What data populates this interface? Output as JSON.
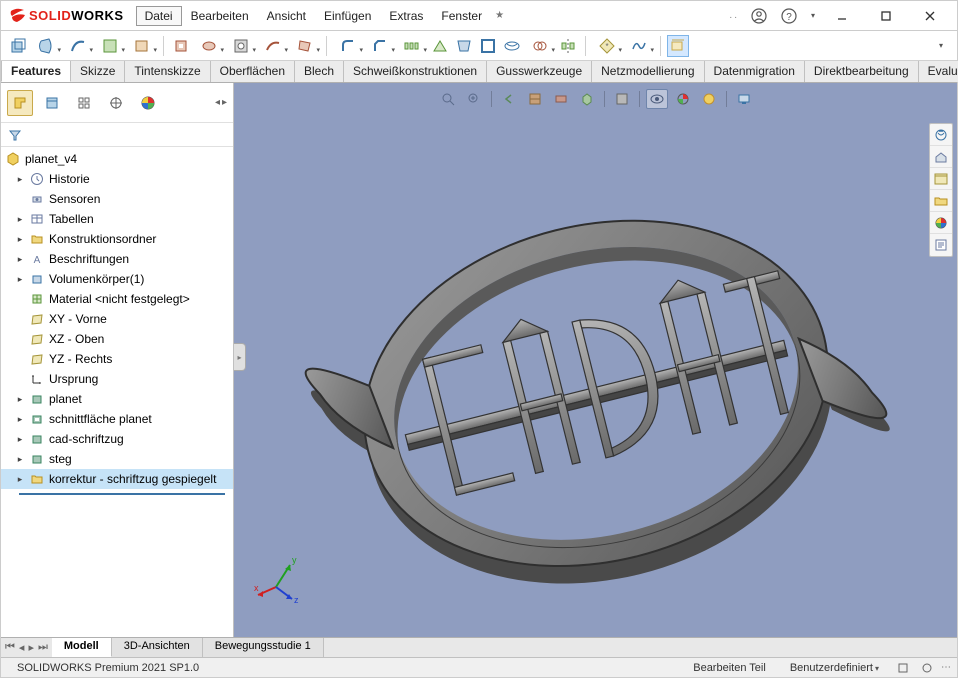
{
  "app": {
    "brand_solid": "SOLID",
    "brand_works": "WORKS"
  },
  "menu": {
    "file": "Datei",
    "edit": "Bearbeiten",
    "view": "Ansicht",
    "insert": "Einfügen",
    "extras": "Extras",
    "window": "Fenster"
  },
  "ribbon": {
    "features": "Features",
    "skizze": "Skizze",
    "tinten": "Tintenskizze",
    "ober": "Oberflächen",
    "blech": "Blech",
    "schweiss": "Schweißkonstruktionen",
    "guss": "Gusswerkzeuge",
    "netz": "Netzmodellierung",
    "daten": "Datenmigration",
    "direkt": "Direktbearbeitung",
    "eval": "Evaluieren"
  },
  "tree": {
    "root": "planet_v4",
    "historie": "Historie",
    "sensoren": "Sensoren",
    "tabellen": "Tabellen",
    "konstr": "Konstruktionsordner",
    "beschr": "Beschriftungen",
    "volumen": "Volumenkörper(1)",
    "material": "Material <nicht festgelegt>",
    "xy": "XY - Vorne",
    "xz": "XZ - Oben",
    "yz": "YZ - Rechts",
    "ursprung": "Ursprung",
    "planet": "planet",
    "schnitt": "schnittfläche planet",
    "cad": "cad-schriftzug",
    "steg": "steg",
    "korrektur": "korrektur - schriftzug gespiegelt"
  },
  "bottom": {
    "modell": "Modell",
    "ansichten": "3D-Ansichten",
    "studie": "Bewegungsstudie 1"
  },
  "status": {
    "version": "SOLIDWORKS Premium 2021 SP1.0",
    "mode": "Bearbeiten Teil",
    "units": "Benutzerdefiniert"
  },
  "triad": {
    "x": "x",
    "y": "y",
    "z": "z"
  }
}
